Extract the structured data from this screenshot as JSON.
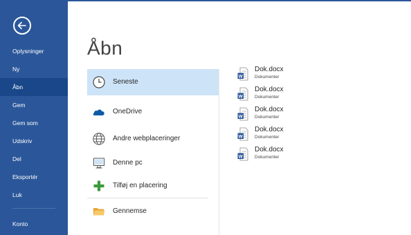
{
  "sidebar": {
    "items": [
      {
        "label": "Oplysninger"
      },
      {
        "label": "Ny"
      },
      {
        "label": "Åbn"
      },
      {
        "label": "Gem"
      },
      {
        "label": "Gem som"
      },
      {
        "label": "Udskriv"
      },
      {
        "label": "Del"
      },
      {
        "label": "Eksportér"
      },
      {
        "label": "Luk"
      },
      {
        "label": "Konto"
      }
    ],
    "selected": "Åbn",
    "background": "#2b579a"
  },
  "main": {
    "title": "Åbn",
    "places": [
      {
        "label": "Seneste",
        "icon": "clock-icon"
      },
      {
        "label": "OneDrive",
        "icon": "cloud-icon"
      },
      {
        "label": "Andre webplaceringer",
        "icon": "globe-icon"
      },
      {
        "label": "Denne pc",
        "icon": "computer-icon"
      },
      {
        "label": "Tilføj en placering",
        "icon": "plus-icon"
      },
      {
        "label": "Gennemse",
        "icon": "folder-icon"
      }
    ],
    "selected_place": "Seneste",
    "recent_documents": [
      {
        "name": "Dok.docx",
        "path": "Dokumenter"
      },
      {
        "name": "Dok.docx",
        "path": "Dokumenter"
      },
      {
        "name": "Dok.docx",
        "path": "Dokumenter"
      },
      {
        "name": "Dok.docx",
        "path": "Dokumenter"
      },
      {
        "name": "Dok.docx",
        "path": "Dokumenter"
      }
    ]
  }
}
